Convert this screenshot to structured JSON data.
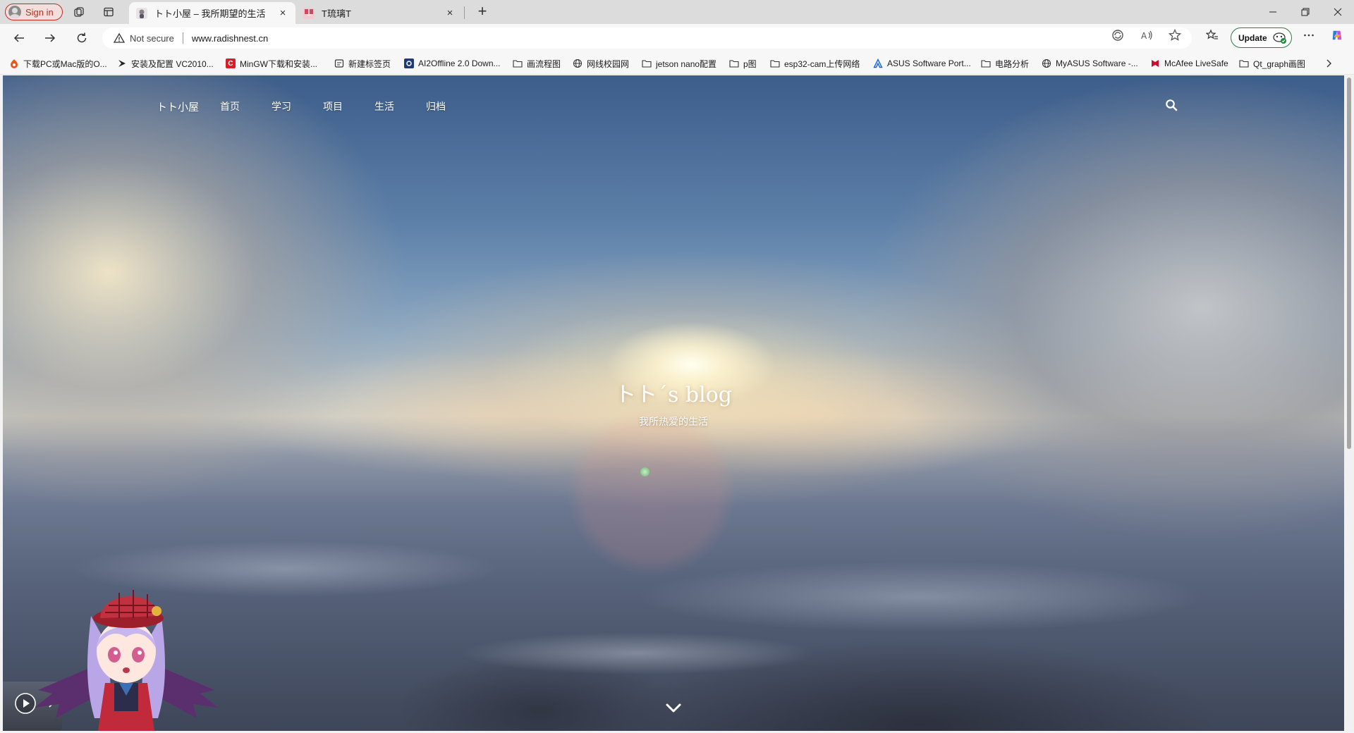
{
  "browser": {
    "sign_in_label": "Sign in",
    "tabs": [
      {
        "title": "トト小屋 – 我所期望的生活",
        "close": "×"
      },
      {
        "title": "T琉璃T",
        "close": "×"
      }
    ],
    "new_tab": "+",
    "window_controls": {
      "minimize": "—",
      "restore": "❐",
      "close": "✕"
    }
  },
  "address_bar": {
    "security_label": "Not secure",
    "url": "www.radishnest.cn",
    "update_label": "Update"
  },
  "bookmarks": [
    {
      "label": "下载PC或Mac版的O...",
      "icon": "orange-app-icon"
    },
    {
      "label": "安装及配置 VC2010...",
      "icon": "black-logo-icon"
    },
    {
      "label": "MinGW下载和安装...",
      "icon": "csdn-icon"
    },
    {
      "label": "新建标签页",
      "icon": "newtab-icon"
    },
    {
      "label": "AI2Offline 2.0 Down...",
      "icon": "blue-square-icon"
    },
    {
      "label": "画流程图",
      "icon": "folder-icon"
    },
    {
      "label": "网线校园网",
      "icon": "globe-icon"
    },
    {
      "label": "jetson nano配置",
      "icon": "folder-icon"
    },
    {
      "label": "p图",
      "icon": "folder-icon"
    },
    {
      "label": "esp32-cam上传网络",
      "icon": "folder-icon"
    },
    {
      "label": "ASUS Software Port...",
      "icon": "asus-icon"
    },
    {
      "label": "电路分析",
      "icon": "folder-icon"
    },
    {
      "label": "MyASUS Software -...",
      "icon": "globe-icon"
    },
    {
      "label": "McAfee LiveSafe",
      "icon": "mcafee-icon"
    },
    {
      "label": "Qt_graph画图",
      "icon": "folder-icon"
    }
  ],
  "site": {
    "brand": "トト小屋",
    "nav": [
      "首页",
      "学习",
      "项目",
      "生活",
      "归档"
    ],
    "hero_title": "トト´s blog",
    "hero_subtitle": "我所热爱的生活"
  }
}
